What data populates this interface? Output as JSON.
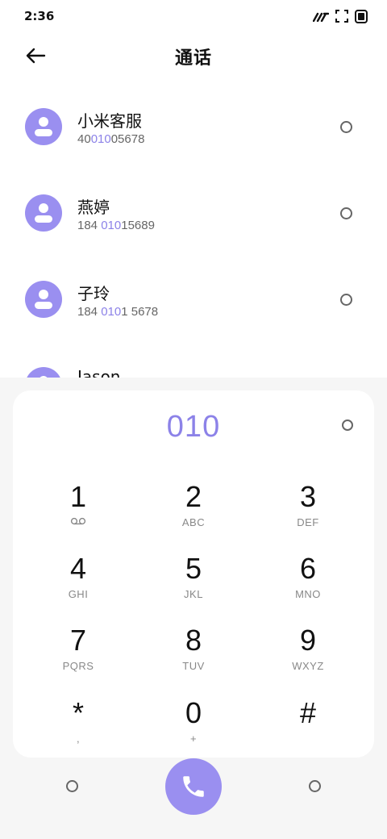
{
  "status_bar": {
    "time": "2:36"
  },
  "header": {
    "title": "通话"
  },
  "contacts": [
    {
      "name": "小米客服",
      "number_pre": "40",
      "number_hl": "010",
      "number_post": "05678"
    },
    {
      "name": "燕婷",
      "number_pre": "184 ",
      "number_hl": "010",
      "number_post": "15689"
    },
    {
      "name": "子玲",
      "number_pre": "184 ",
      "number_hl": "010",
      "number_post": "1 5678"
    },
    {
      "name": "Jason",
      "number_pre": "",
      "number_hl": "",
      "number_post": ""
    }
  ],
  "dialpad": {
    "display": "010",
    "keys": [
      {
        "digit": "1",
        "letters": "",
        "icon": "voicemail-icon"
      },
      {
        "digit": "2",
        "letters": "ABC"
      },
      {
        "digit": "3",
        "letters": "DEF"
      },
      {
        "digit": "4",
        "letters": "GHI"
      },
      {
        "digit": "5",
        "letters": "JKL"
      },
      {
        "digit": "6",
        "letters": "MNO"
      },
      {
        "digit": "7",
        "letters": "PQRS"
      },
      {
        "digit": "8",
        "letters": "TUV"
      },
      {
        "digit": "9",
        "letters": "WXYZ"
      },
      {
        "digit": "*",
        "letters": ","
      },
      {
        "digit": "0",
        "letters": "+"
      },
      {
        "digit": "#",
        "letters": ""
      }
    ]
  },
  "colors": {
    "accent": "#8c82e8",
    "avatar": "#9a8ff0",
    "panel_bg": "#f6f6f6"
  }
}
